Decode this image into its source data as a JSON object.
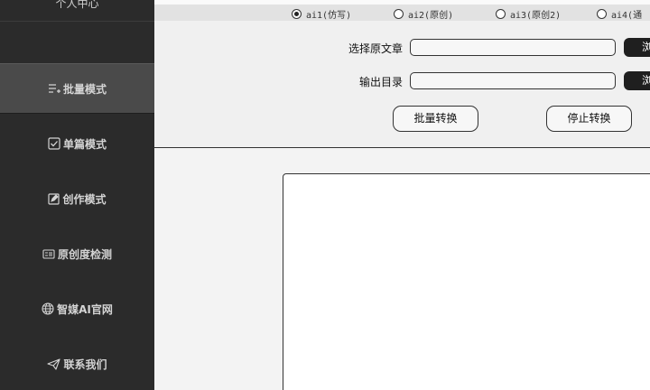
{
  "sidebar": {
    "header_label": "个人中心",
    "items": [
      {
        "label": "批量模式",
        "icon": "list-plus-icon",
        "active": true
      },
      {
        "label": "单篇模式",
        "icon": "checkbox-icon",
        "active": false
      },
      {
        "label": "创作模式",
        "icon": "edit-icon",
        "active": false
      },
      {
        "label": "原创度检测",
        "icon": "detect-icon",
        "active": false
      },
      {
        "label": "智媒AI官网",
        "icon": "globe-icon",
        "active": false
      },
      {
        "label": "联系我们",
        "icon": "send-icon",
        "active": false
      }
    ]
  },
  "mode_options": {
    "selected": "ai1(仿写)",
    "options": [
      "ai1(仿写)",
      "ai2(原创)",
      "ai3(原创2)",
      "ai4(通"
    ]
  },
  "form": {
    "source_label": "选择原文章",
    "source_value": "",
    "output_label": "输出目录",
    "output_value": "",
    "browse_button_1": "浏",
    "browse_button_2": "浏",
    "start_button": "批量转换",
    "stop_button": "停止转换"
  },
  "log": {
    "text": ""
  },
  "colors": {
    "sidebar_bg": "#2b2b2b",
    "sidebar_active": "#4a4a4a",
    "panel_bg": "#f0f0f0",
    "dark_button": "#1f1f1f"
  }
}
